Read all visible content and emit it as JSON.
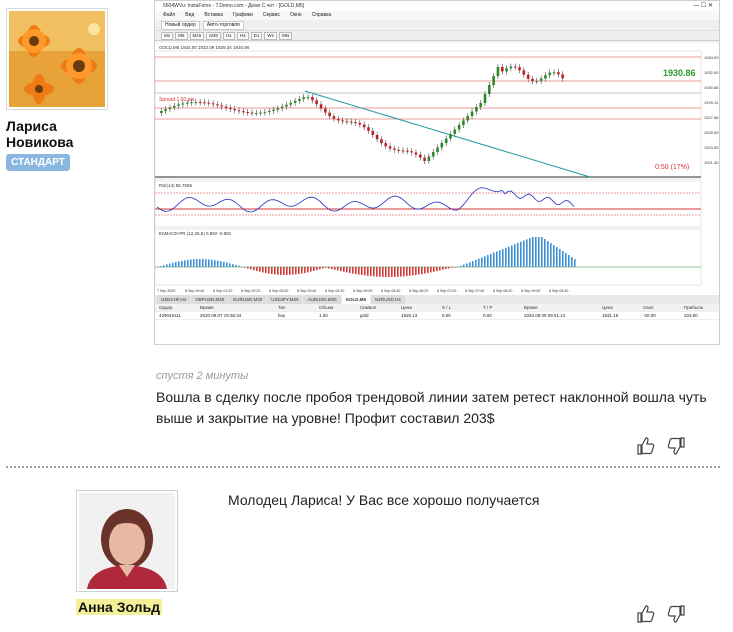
{
  "post": {
    "author": "Лариса Новикова",
    "author_line1": "Лариса",
    "author_line2": "Новикова",
    "badge": "СТАНДАРТ",
    "time_ago": "спустя 2 минуты",
    "message": "Вошла в сделку после пробоя трендовой линии затем ретест наклонной вошла чуть выше и закрытие на уровне! Профит составил 203$"
  },
  "screenshot": {
    "window_title": "5604WVu: InstaForex - T.Demo.com - Демо С.чет - [GOLD,M5]",
    "menu": [
      "Файл",
      "Вид",
      "Вставка",
      "Графики",
      "Сервис",
      "Окно",
      "Справка"
    ],
    "toolbar_new_order": "Новый ордер",
    "toolbar_autotrade": "Авто-торговля",
    "timeframes": [
      "M1",
      "M5",
      "M15",
      "M30",
      "H1",
      "H4",
      "D1",
      "W1",
      "MN"
    ],
    "chart_header": "GOLD,M5 1932.00 1932.09 1929.34 1930.86",
    "price_label": "1930.86",
    "spread_label": "Spread 1.00 pts",
    "countdown_label": "0:50 (17%)",
    "rsi_label": "RSI(14) 55.7596",
    "macd_label": "EnMACD-PR (12,26,9) 0.892 -0.891",
    "time_labels": [
      "7 Sep 2020",
      "8 Sep 00:40",
      "8 Sep 01:20",
      "8 Sep 02:20",
      "8 Sep 03:00",
      "8 Sep 03:40",
      "8 Sep 04:20",
      "8 Sep 05:00",
      "8 Sep 05:40",
      "8 Sep 06:20",
      "8 Sep 07:00",
      "8 Sep 07:40",
      "8 Sep 08:20",
      "8 Sep 09:00",
      "8 Sep 09:40"
    ],
    "price_axis": [
      "1934.00",
      "1932.00",
      "1930.86",
      "1929.12",
      "1927.56",
      "1925.00",
      "1923.55",
      "1921.30"
    ],
    "symbol_tabs": [
      "USDCHF,H1",
      "GBPUSD,M30",
      "EURUSD,M30",
      "USDJPY,M30",
      "AUDUSD,M30",
      "GOLD,M5",
      "NZDUSD,H4"
    ],
    "active_symbol": "GOLD,M5",
    "order_columns": [
      "Ордер",
      "Время",
      "Тип",
      "Объем",
      "Символ",
      "Цена",
      "S / L",
      "T / P",
      "Время",
      "Цена",
      "Своп",
      "Прибыль"
    ],
    "order_row": [
      "429049111",
      "2020.09.07 19:36:34",
      "buy",
      "1.00",
      "gold",
      "1929.13",
      "0.00",
      "0.00",
      "2020.09.08 09:51:12",
      "1931.16",
      "-20.00",
      "203.00"
    ]
  },
  "reply": {
    "author": "Анна Зольд",
    "message": "Молодец Лариса! У Вас все хорошо получается"
  },
  "icons": {
    "like": "thumbs-up-icon",
    "dislike": "thumbs-down-icon"
  },
  "colors": {
    "badge": "#8ab7e0",
    "author_highlight": "#f4f09a",
    "bull_candle": "#2a8a2a",
    "bear_candle": "#c22020",
    "trendline": "#1e9aa0",
    "rsi_line": "#2030c0",
    "macd_bar": "#3d8fd6",
    "macd_bar_neg": "#d23a3a"
  }
}
